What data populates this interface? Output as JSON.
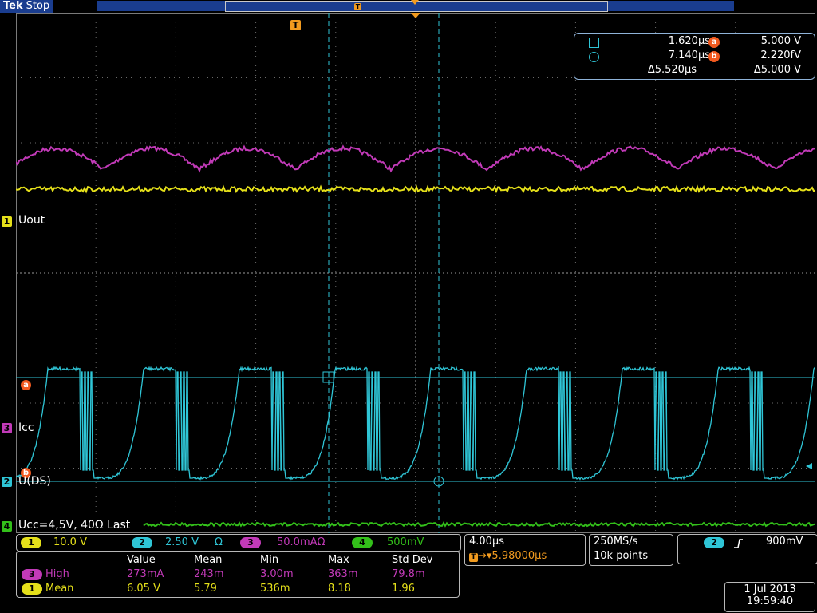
{
  "header": {
    "brand": "Tek",
    "state": "Stop"
  },
  "trigger_marker": "T",
  "channels": {
    "ch1": {
      "number": "1",
      "name": "Uout",
      "scale": "10.0 V",
      "color": "#e5e01a"
    },
    "ch2": {
      "number": "2",
      "name": "U(DS)",
      "scale": "2.50 V",
      "unit_symbol": "Ω",
      "color": "#2fc5d6"
    },
    "ch3": {
      "number": "3",
      "name": "Icc",
      "scale": "50.0mAΩ",
      "color": "#c23ab8"
    },
    "ch4": {
      "number": "4",
      "name": "Ucc=4,5V, 40Ω Last",
      "scale": "500mV",
      "color": "#33c01a"
    }
  },
  "ref_markers": {
    "a": "a",
    "b": "b"
  },
  "cursor_readout": {
    "t1": "1.620µs",
    "t2": "7.140µs",
    "dt": "Δ5.520µs",
    "va": "5.000 V",
    "vb": "2.220fV",
    "dv": "Δ5.000 V",
    "a_label": "a",
    "b_label": "b"
  },
  "measurements": {
    "headers": [
      "Value",
      "Mean",
      "Min",
      "Max",
      "Std Dev"
    ],
    "rows": [
      {
        "channel": "3",
        "label": "High",
        "color": "#c23ab8",
        "values": [
          "273mA",
          "243m",
          "3.00m",
          "363m",
          "79.8m"
        ]
      },
      {
        "channel": "1",
        "label": "Mean",
        "color": "#e5e01a",
        "values": [
          "6.05 V",
          "5.79",
          "536m",
          "8.18",
          "1.96"
        ]
      }
    ]
  },
  "timebase": {
    "scale": "4.00µs",
    "position": "5.98000µs",
    "pos_marker": "T"
  },
  "acquisition": {
    "rate": "250MS/s",
    "points": "10k points"
  },
  "trigger": {
    "channel": "2",
    "slope_icon": "rising-edge-icon",
    "level": "900mV"
  },
  "datetime": {
    "date": "1 Jul  2013",
    "time": "19:59:40"
  }
}
